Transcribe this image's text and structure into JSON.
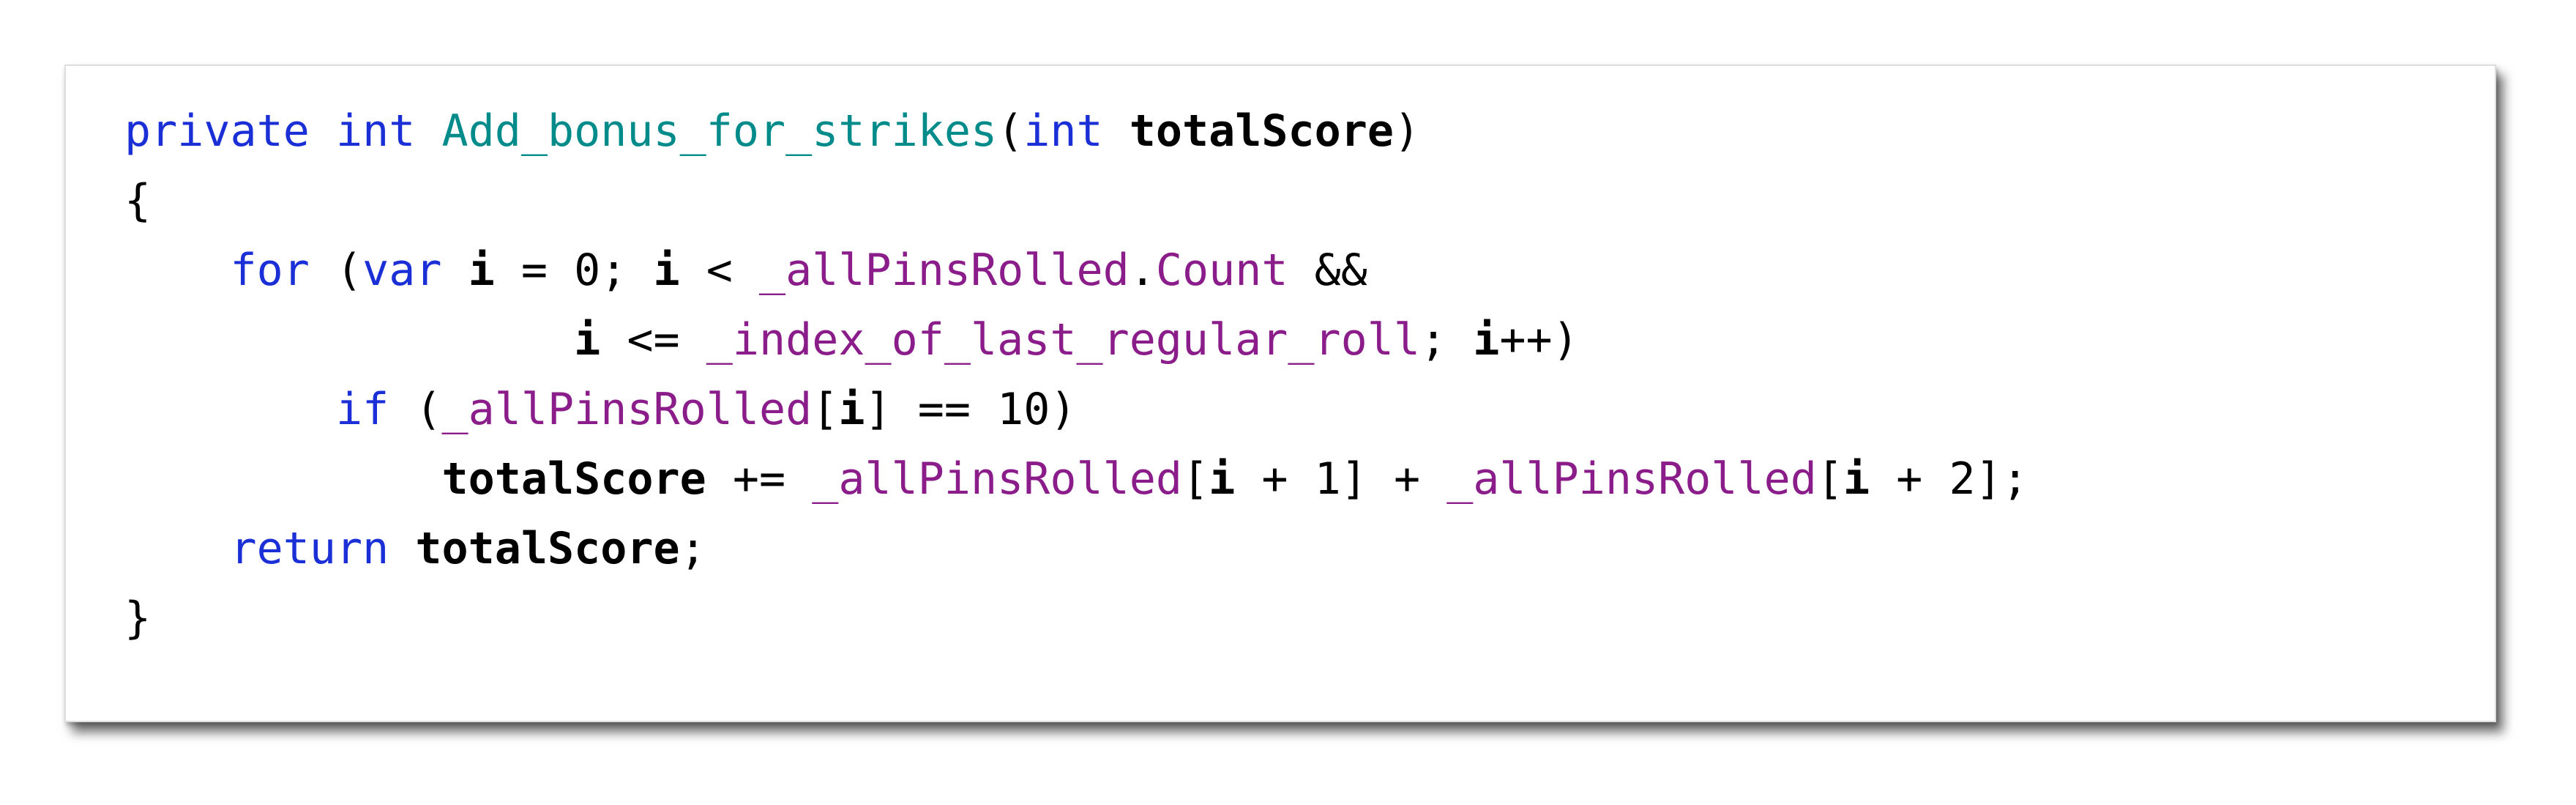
{
  "code": {
    "colors": {
      "keyword": "#1a2fd6",
      "method_name": "#008b8b",
      "member": "#8b1d8b",
      "field": "#8b1d8b",
      "identifier": "#000000",
      "background": "#ffffff"
    },
    "lines": [
      {
        "tokens": [
          {
            "type": "kw",
            "text": "private"
          },
          {
            "type": "pl",
            "text": " "
          },
          {
            "type": "kw",
            "text": "int"
          },
          {
            "type": "pl",
            "text": " "
          },
          {
            "type": "fn",
            "text": "Add_bonus_for_strikes"
          },
          {
            "type": "pl",
            "text": "("
          },
          {
            "type": "kw",
            "text": "int"
          },
          {
            "type": "pl",
            "text": " "
          },
          {
            "type": "id",
            "text": "totalScore"
          },
          {
            "type": "pl",
            "text": ")"
          }
        ]
      },
      {
        "tokens": [
          {
            "type": "pl",
            "text": "{"
          }
        ]
      },
      {
        "tokens": [
          {
            "type": "pl",
            "text": "    "
          },
          {
            "type": "kw",
            "text": "for"
          },
          {
            "type": "pl",
            "text": " ("
          },
          {
            "type": "kw",
            "text": "var"
          },
          {
            "type": "pl",
            "text": " "
          },
          {
            "type": "id",
            "text": "i"
          },
          {
            "type": "pl",
            "text": " = 0; "
          },
          {
            "type": "id",
            "text": "i"
          },
          {
            "type": "pl",
            "text": " < "
          },
          {
            "type": "fd",
            "text": "_allPinsRolled"
          },
          {
            "type": "pl",
            "text": "."
          },
          {
            "type": "pr",
            "text": "Count"
          },
          {
            "type": "pl",
            "text": " &&"
          }
        ]
      },
      {
        "tokens": [
          {
            "type": "pl",
            "text": "                 "
          },
          {
            "type": "id",
            "text": "i"
          },
          {
            "type": "pl",
            "text": " <= "
          },
          {
            "type": "fd",
            "text": "_index_of_last_regular_roll"
          },
          {
            "type": "pl",
            "text": "; "
          },
          {
            "type": "id",
            "text": "i"
          },
          {
            "type": "pl",
            "text": "++)"
          }
        ]
      },
      {
        "tokens": [
          {
            "type": "pl",
            "text": "        "
          },
          {
            "type": "kw",
            "text": "if"
          },
          {
            "type": "pl",
            "text": " ("
          },
          {
            "type": "fd",
            "text": "_allPinsRolled"
          },
          {
            "type": "pl",
            "text": "["
          },
          {
            "type": "id",
            "text": "i"
          },
          {
            "type": "pl",
            "text": "] == 10)"
          }
        ]
      },
      {
        "tokens": [
          {
            "type": "pl",
            "text": "            "
          },
          {
            "type": "id",
            "text": "totalScore"
          },
          {
            "type": "pl",
            "text": " += "
          },
          {
            "type": "fd",
            "text": "_allPinsRolled"
          },
          {
            "type": "pl",
            "text": "["
          },
          {
            "type": "id",
            "text": "i"
          },
          {
            "type": "pl",
            "text": " + 1] + "
          },
          {
            "type": "fd",
            "text": "_allPinsRolled"
          },
          {
            "type": "pl",
            "text": "["
          },
          {
            "type": "id",
            "text": "i"
          },
          {
            "type": "pl",
            "text": " + 2];"
          }
        ]
      },
      {
        "tokens": [
          {
            "type": "pl",
            "text": "    "
          },
          {
            "type": "kw",
            "text": "return"
          },
          {
            "type": "pl",
            "text": " "
          },
          {
            "type": "id",
            "text": "totalScore"
          },
          {
            "type": "pl",
            "text": ";"
          }
        ]
      },
      {
        "tokens": [
          {
            "type": "pl",
            "text": "}"
          }
        ]
      }
    ]
  }
}
